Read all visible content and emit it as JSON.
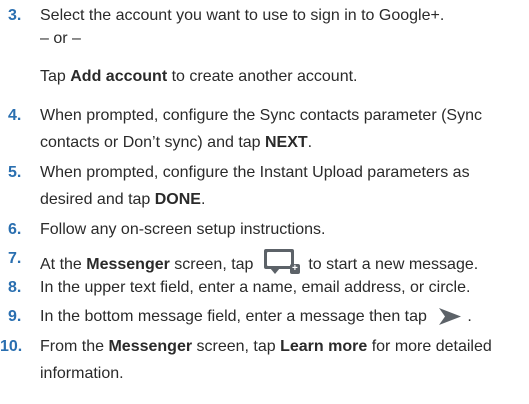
{
  "steps": [
    {
      "number": "3.",
      "line1": "Select the account you want to use to sign in to Google+.",
      "or": "– or –",
      "tap_word": "Tap ",
      "add_account": "Add account",
      "after": " to create another account."
    },
    {
      "number": "4.",
      "line1": "When prompted, configure the Sync contacts parameter (Sync",
      "line2_pre": "contacts or Don’t sync) and tap ",
      "next": "NEXT",
      "line2_post": "."
    },
    {
      "number": "5.",
      "line1": "When prompted, configure the Instant Upload parameters as",
      "line2_pre": "desired and tap ",
      "done": "DONE",
      "line2_post": "."
    },
    {
      "number": "6.",
      "text": "Follow any on-screen setup instructions."
    },
    {
      "number": "7.",
      "pre": "At the ",
      "messenger": "Messenger",
      "mid": " screen, tap ",
      "post": " to start a new message.",
      "icon": "new-message-icon"
    },
    {
      "number": "8.",
      "text": "In the upper text field, enter a name, email address, or circle."
    },
    {
      "number": "9.",
      "pre": "In the bottom message field, enter a message then tap ",
      "post": ".",
      "icon": "send-icon"
    },
    {
      "number": "10.",
      "pre": "From the ",
      "messenger": "Messenger",
      "mid": " screen, tap ",
      "learn_more": "Learn more",
      "post": " for more detailed",
      "line2": "information."
    }
  ],
  "colors": {
    "step_number": "#2a6fb0",
    "icon_gray": "#5c6268"
  }
}
